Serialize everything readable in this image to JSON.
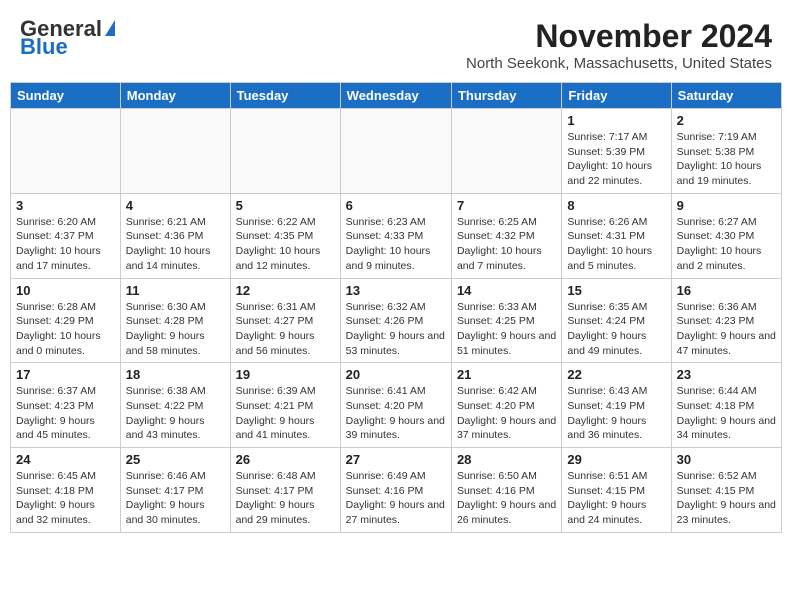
{
  "logo": {
    "line1": "General",
    "line2": "Blue"
  },
  "title": "November 2024",
  "location": "North Seekonk, Massachusetts, United States",
  "days_of_week": [
    "Sunday",
    "Monday",
    "Tuesday",
    "Wednesday",
    "Thursday",
    "Friday",
    "Saturday"
  ],
  "weeks": [
    [
      {
        "day": "",
        "info": ""
      },
      {
        "day": "",
        "info": ""
      },
      {
        "day": "",
        "info": ""
      },
      {
        "day": "",
        "info": ""
      },
      {
        "day": "",
        "info": ""
      },
      {
        "day": "1",
        "info": "Sunrise: 7:17 AM\nSunset: 5:39 PM\nDaylight: 10 hours and 22 minutes."
      },
      {
        "day": "2",
        "info": "Sunrise: 7:19 AM\nSunset: 5:38 PM\nDaylight: 10 hours and 19 minutes."
      }
    ],
    [
      {
        "day": "3",
        "info": "Sunrise: 6:20 AM\nSunset: 4:37 PM\nDaylight: 10 hours and 17 minutes."
      },
      {
        "day": "4",
        "info": "Sunrise: 6:21 AM\nSunset: 4:36 PM\nDaylight: 10 hours and 14 minutes."
      },
      {
        "day": "5",
        "info": "Sunrise: 6:22 AM\nSunset: 4:35 PM\nDaylight: 10 hours and 12 minutes."
      },
      {
        "day": "6",
        "info": "Sunrise: 6:23 AM\nSunset: 4:33 PM\nDaylight: 10 hours and 9 minutes."
      },
      {
        "day": "7",
        "info": "Sunrise: 6:25 AM\nSunset: 4:32 PM\nDaylight: 10 hours and 7 minutes."
      },
      {
        "day": "8",
        "info": "Sunrise: 6:26 AM\nSunset: 4:31 PM\nDaylight: 10 hours and 5 minutes."
      },
      {
        "day": "9",
        "info": "Sunrise: 6:27 AM\nSunset: 4:30 PM\nDaylight: 10 hours and 2 minutes."
      }
    ],
    [
      {
        "day": "10",
        "info": "Sunrise: 6:28 AM\nSunset: 4:29 PM\nDaylight: 10 hours and 0 minutes."
      },
      {
        "day": "11",
        "info": "Sunrise: 6:30 AM\nSunset: 4:28 PM\nDaylight: 9 hours and 58 minutes."
      },
      {
        "day": "12",
        "info": "Sunrise: 6:31 AM\nSunset: 4:27 PM\nDaylight: 9 hours and 56 minutes."
      },
      {
        "day": "13",
        "info": "Sunrise: 6:32 AM\nSunset: 4:26 PM\nDaylight: 9 hours and 53 minutes."
      },
      {
        "day": "14",
        "info": "Sunrise: 6:33 AM\nSunset: 4:25 PM\nDaylight: 9 hours and 51 minutes."
      },
      {
        "day": "15",
        "info": "Sunrise: 6:35 AM\nSunset: 4:24 PM\nDaylight: 9 hours and 49 minutes."
      },
      {
        "day": "16",
        "info": "Sunrise: 6:36 AM\nSunset: 4:23 PM\nDaylight: 9 hours and 47 minutes."
      }
    ],
    [
      {
        "day": "17",
        "info": "Sunrise: 6:37 AM\nSunset: 4:23 PM\nDaylight: 9 hours and 45 minutes."
      },
      {
        "day": "18",
        "info": "Sunrise: 6:38 AM\nSunset: 4:22 PM\nDaylight: 9 hours and 43 minutes."
      },
      {
        "day": "19",
        "info": "Sunrise: 6:39 AM\nSunset: 4:21 PM\nDaylight: 9 hours and 41 minutes."
      },
      {
        "day": "20",
        "info": "Sunrise: 6:41 AM\nSunset: 4:20 PM\nDaylight: 9 hours and 39 minutes."
      },
      {
        "day": "21",
        "info": "Sunrise: 6:42 AM\nSunset: 4:20 PM\nDaylight: 9 hours and 37 minutes."
      },
      {
        "day": "22",
        "info": "Sunrise: 6:43 AM\nSunset: 4:19 PM\nDaylight: 9 hours and 36 minutes."
      },
      {
        "day": "23",
        "info": "Sunrise: 6:44 AM\nSunset: 4:18 PM\nDaylight: 9 hours and 34 minutes."
      }
    ],
    [
      {
        "day": "24",
        "info": "Sunrise: 6:45 AM\nSunset: 4:18 PM\nDaylight: 9 hours and 32 minutes."
      },
      {
        "day": "25",
        "info": "Sunrise: 6:46 AM\nSunset: 4:17 PM\nDaylight: 9 hours and 30 minutes."
      },
      {
        "day": "26",
        "info": "Sunrise: 6:48 AM\nSunset: 4:17 PM\nDaylight: 9 hours and 29 minutes."
      },
      {
        "day": "27",
        "info": "Sunrise: 6:49 AM\nSunset: 4:16 PM\nDaylight: 9 hours and 27 minutes."
      },
      {
        "day": "28",
        "info": "Sunrise: 6:50 AM\nSunset: 4:16 PM\nDaylight: 9 hours and 26 minutes."
      },
      {
        "day": "29",
        "info": "Sunrise: 6:51 AM\nSunset: 4:15 PM\nDaylight: 9 hours and 24 minutes."
      },
      {
        "day": "30",
        "info": "Sunrise: 6:52 AM\nSunset: 4:15 PM\nDaylight: 9 hours and 23 minutes."
      }
    ]
  ]
}
